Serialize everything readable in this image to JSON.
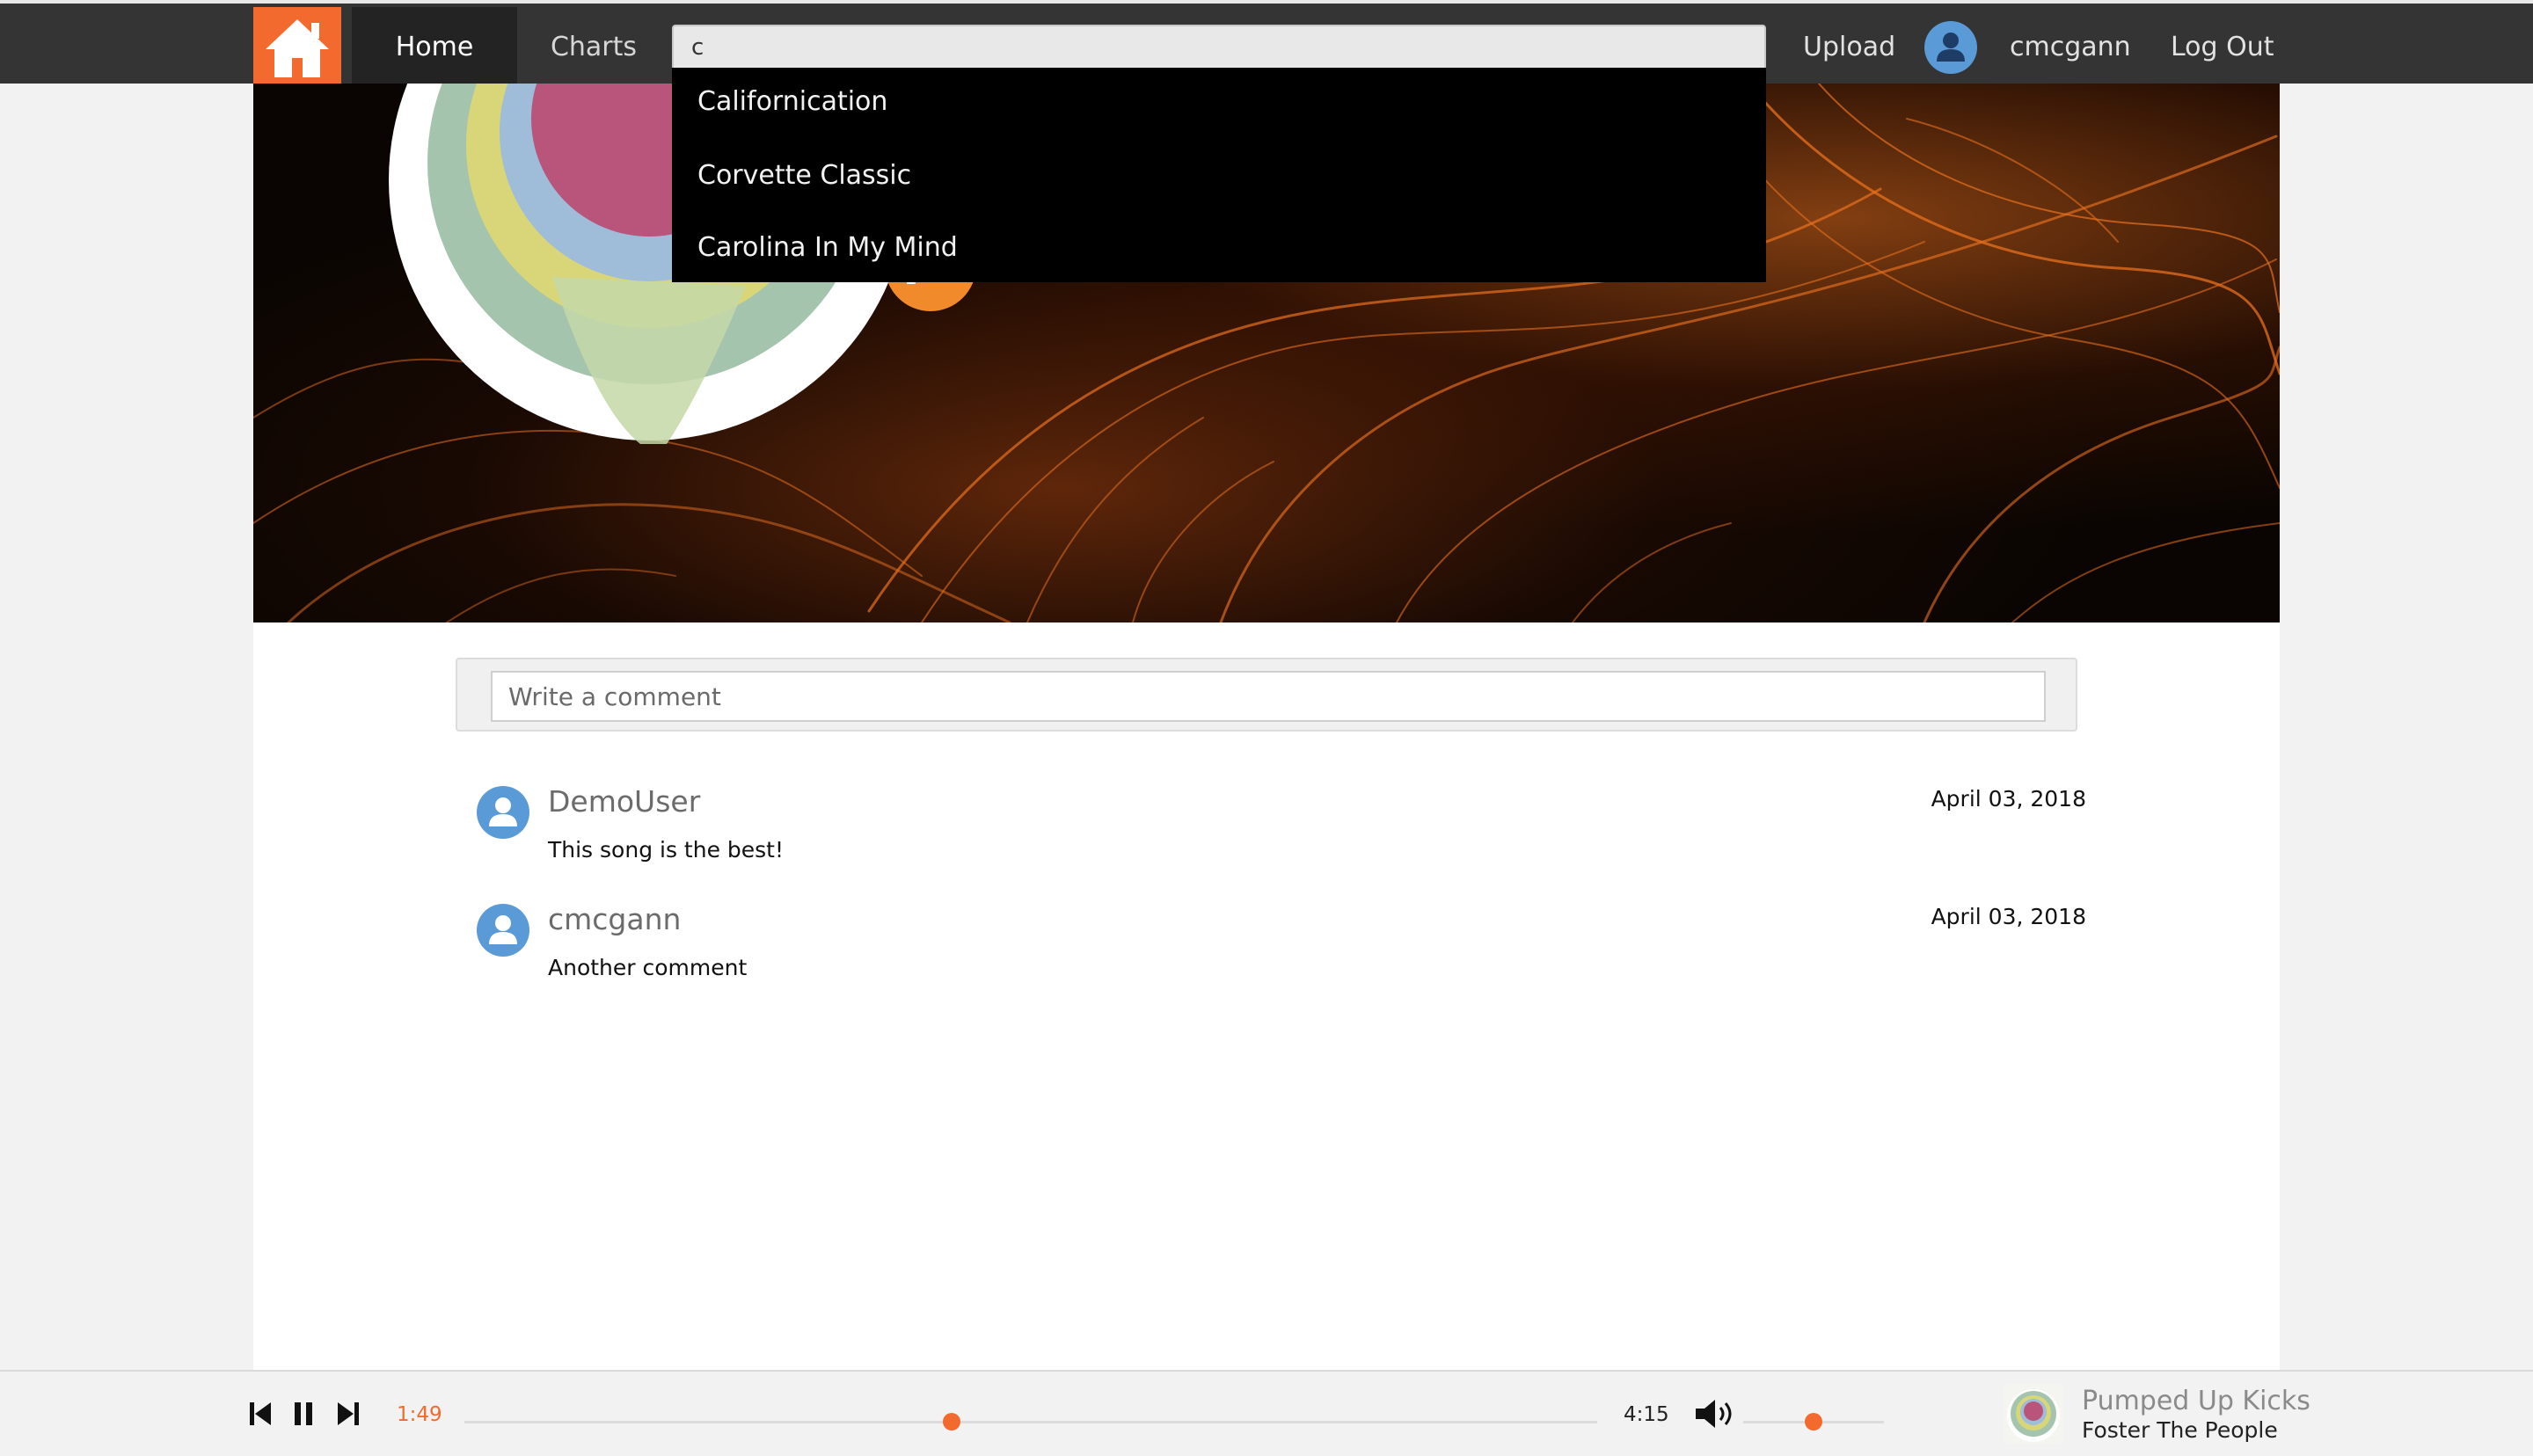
{
  "nav": {
    "home_tab": "Home",
    "charts_tab": "Charts",
    "upload": "Upload",
    "username": "cmcgann",
    "logout": "Log Out"
  },
  "search": {
    "value": "c",
    "suggestions": [
      "Californication",
      "Corvette Classic",
      "Carolina In My Mind"
    ]
  },
  "comments": {
    "placeholder": "Write a comment",
    "items": [
      {
        "user": "DemoUser",
        "text": "This song is the best!",
        "date": "April 03, 2018"
      },
      {
        "user": "cmcgann",
        "text": "Another comment",
        "date": "April 03, 2018"
      }
    ]
  },
  "player": {
    "current_time": "1:49",
    "total_time": "4:15",
    "progress_fraction": 0.43,
    "volume_fraction": 0.5,
    "track_title": "Pumped Up Kicks",
    "track_artist": "Foster The People",
    "accent_color": "#f26a2d"
  },
  "icons": [
    "home-icon",
    "user-avatar-icon",
    "previous-icon",
    "pause-icon",
    "next-icon",
    "volume-icon"
  ]
}
